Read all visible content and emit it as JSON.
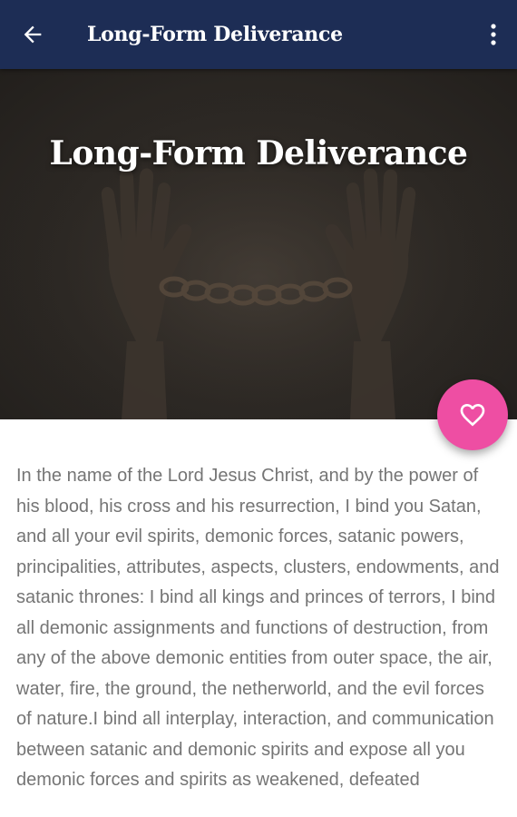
{
  "toolbar": {
    "title": "Long-Form Deliverance",
    "back_icon": "arrow-left-icon",
    "menu_icon": "more-vertical-icon",
    "background_color": "#1d2d55"
  },
  "hero": {
    "title": "Long-Form Deliverance",
    "image": "chained-hands-image"
  },
  "fab": {
    "icon": "heart-outline-icon",
    "color": "#ee4ea3"
  },
  "content": {
    "text": "In the name of the Lord Jesus Christ, and by the power of his blood, his cross and his resurrection, I bind you Satan, and all your evil spirits, demonic forces, satanic powers, principalities, attributes, aspects, clusters, endowments, and satanic thrones: I bind all kings and princes of terrors, I bind all demonic assignments and functions of destruction, from any of the above demonic entities from outer space, the air, water, fire, the ground, the netherworld, and the evil forces of nature.I bind all interplay, interaction, and communication between satanic and demonic spirits and expose all you demonic forces and spirits as weakened, defeated"
  }
}
